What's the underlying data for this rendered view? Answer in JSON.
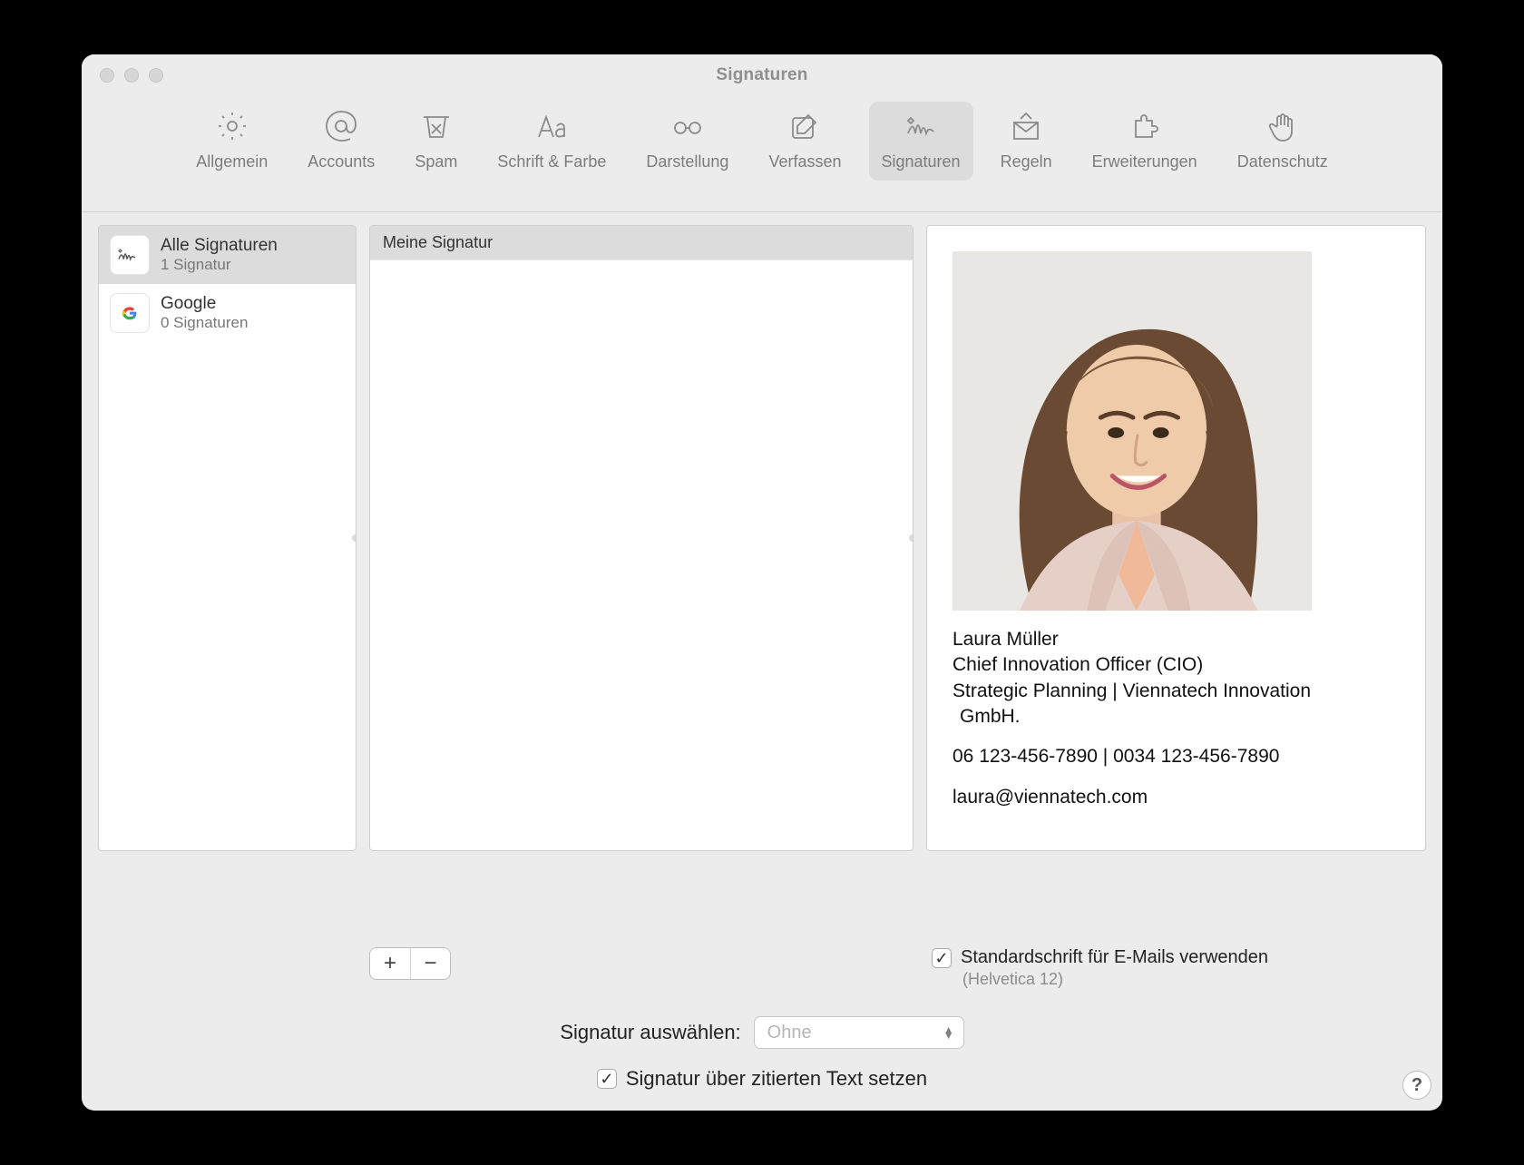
{
  "window": {
    "title": "Signaturen"
  },
  "toolbar": {
    "items": [
      {
        "label": "Allgemein"
      },
      {
        "label": "Accounts"
      },
      {
        "label": "Spam"
      },
      {
        "label": "Schrift & Farbe"
      },
      {
        "label": "Darstellung"
      },
      {
        "label": "Verfassen"
      },
      {
        "label": "Signaturen"
      },
      {
        "label": "Regeln"
      },
      {
        "label": "Erweiterungen"
      },
      {
        "label": "Datenschutz"
      }
    ]
  },
  "accounts": [
    {
      "title": "Alle Signaturen",
      "subtitle": "1 Signatur"
    },
    {
      "title": "Google",
      "subtitle": "0 Signaturen"
    }
  ],
  "signature_list": {
    "items": [
      {
        "name": "Meine Signatur"
      }
    ]
  },
  "buttons": {
    "add": "+",
    "remove": "−"
  },
  "preview": {
    "name": "Laura Müller",
    "title": "Chief Innovation Officer (CIO)",
    "dept_line": "Strategic Planning | Viennatech Innovation",
    "company_suffix": " GmbH.",
    "phones": "06 123-456-7890 | 0034 123-456-7890",
    "email": "laura@viennatech.com"
  },
  "stdfont": {
    "checkbox_label": "Standardschrift für E-Mails verwenden",
    "font_display": "(Helvetica 12)",
    "checked": true
  },
  "select_signature": {
    "label": "Signatur auswählen:",
    "value": "Ohne"
  },
  "place_above": {
    "label": "Signatur über zitierten Text setzen",
    "checked": true
  },
  "help": {
    "label": "?"
  }
}
